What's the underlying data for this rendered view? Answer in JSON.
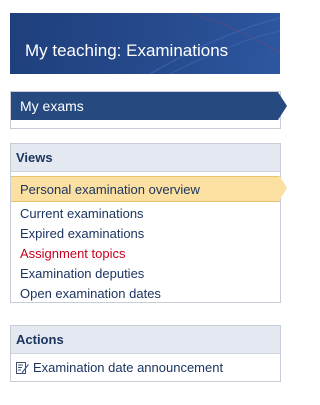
{
  "header": {
    "title": "My teaching: Examinations"
  },
  "my_exams": {
    "label": "My exams"
  },
  "views": {
    "title": "Views",
    "active_item": "Personal examination overview",
    "items": [
      "Current examinations",
      "Expired examinations",
      "Assignment topics",
      "Examination deputies",
      "Open examination dates"
    ]
  },
  "actions": {
    "title": "Actions",
    "items": [
      {
        "label": "Examination date announcement",
        "icon": "edit-document-icon"
      }
    ]
  },
  "colors": {
    "header_bg": "#264a8c",
    "nav_bar_bg": "#26497f",
    "active_bg": "#fbe0a2",
    "link": "#1c3560",
    "link_highlight": "#c8001e",
    "panel_title_bg": "#e4e8f0"
  }
}
